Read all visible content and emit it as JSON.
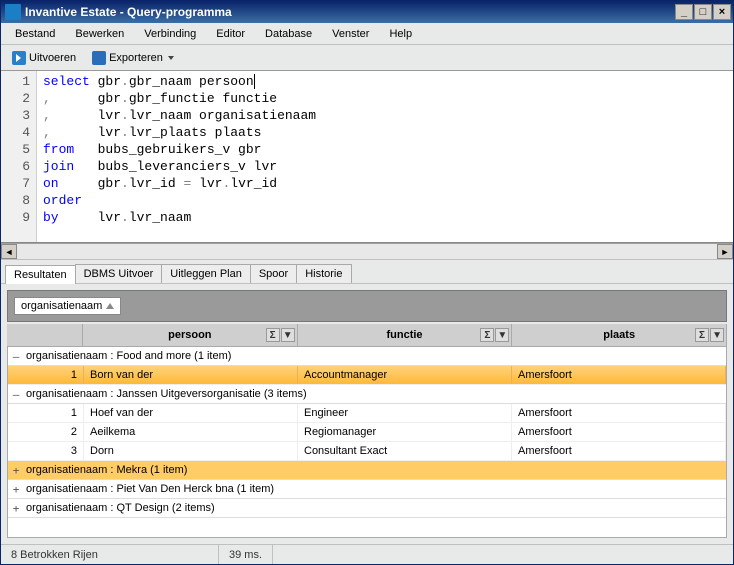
{
  "title": "Invantive Estate - Query-programma",
  "menu": [
    "Bestand",
    "Bewerken",
    "Verbinding",
    "Editor",
    "Database",
    "Venster",
    "Help"
  ],
  "toolbar": {
    "run": "Uitvoeren",
    "export": "Exporteren"
  },
  "code": {
    "lines": [
      "1",
      "2",
      "3",
      "4",
      "5",
      "6",
      "7",
      "8",
      "9"
    ],
    "tokens": [
      [
        {
          "t": "select",
          "c": "kw"
        },
        {
          "t": " gbr"
        },
        {
          "t": ".",
          "c": "pn"
        },
        {
          "t": "gbr_naam persoon"
        }
      ],
      [
        {
          "t": ",",
          "c": "pn"
        },
        {
          "t": "      gbr"
        },
        {
          "t": ".",
          "c": "pn"
        },
        {
          "t": "gbr_functie functie"
        }
      ],
      [
        {
          "t": ",",
          "c": "pn"
        },
        {
          "t": "      lvr"
        },
        {
          "t": ".",
          "c": "pn"
        },
        {
          "t": "lvr_naam organisatienaam"
        }
      ],
      [
        {
          "t": ",",
          "c": "pn"
        },
        {
          "t": "      lvr"
        },
        {
          "t": ".",
          "c": "pn"
        },
        {
          "t": "lvr_plaats plaats"
        }
      ],
      [
        {
          "t": "from",
          "c": "kw"
        },
        {
          "t": "   bubs_gebruikers_v gbr"
        }
      ],
      [
        {
          "t": "join",
          "c": "kw"
        },
        {
          "t": "   bubs_leveranciers_v lvr"
        }
      ],
      [
        {
          "t": "on",
          "c": "kw"
        },
        {
          "t": "     gbr"
        },
        {
          "t": ".",
          "c": "pn"
        },
        {
          "t": "lvr_id "
        },
        {
          "t": "=",
          "c": "pn"
        },
        {
          "t": " lvr"
        },
        {
          "t": ".",
          "c": "pn"
        },
        {
          "t": "lvr_id"
        }
      ],
      [
        {
          "t": "order",
          "c": "kw"
        }
      ],
      [
        {
          "t": "by",
          "c": "kw"
        },
        {
          "t": "     lvr"
        },
        {
          "t": ".",
          "c": "pn"
        },
        {
          "t": "lvr_naam"
        }
      ]
    ]
  },
  "tabs": [
    "Resultaten",
    "DBMS Uitvoer",
    "Uitleggen Plan",
    "Spoor",
    "Historie"
  ],
  "activeTab": 0,
  "grouping": {
    "chip": "organisatienaam"
  },
  "columns": [
    "persoon",
    "functie",
    "plaats"
  ],
  "groups": [
    {
      "expanded": true,
      "hl": false,
      "label": "organisatienaam : Food and more (1 item)",
      "rows": [
        {
          "n": "1",
          "hl": true,
          "cells": [
            "Born van der",
            "Accountmanager",
            "Amersfoort"
          ]
        }
      ]
    },
    {
      "expanded": true,
      "hl": false,
      "label": "organisatienaam : Janssen Uitgeversorganisatie (3 items)",
      "rows": [
        {
          "n": "1",
          "hl": false,
          "cells": [
            "Hoef van der",
            "Engineer",
            "Amersfoort"
          ]
        },
        {
          "n": "2",
          "hl": false,
          "cells": [
            "Aeilkema",
            "Regiomanager",
            "Amersfoort"
          ]
        },
        {
          "n": "3",
          "hl": false,
          "cells": [
            "Dorn",
            "Consultant Exact",
            "Amersfoort"
          ]
        }
      ]
    },
    {
      "expanded": false,
      "hl": true,
      "label": "organisatienaam : Mekra (1 item)",
      "rows": []
    },
    {
      "expanded": false,
      "hl": false,
      "label": "organisatienaam : Piet Van Den Herck bna (1 item)",
      "rows": []
    },
    {
      "expanded": false,
      "hl": false,
      "label": "organisatienaam : QT Design (2 items)",
      "rows": []
    }
  ],
  "status": {
    "rows": "8 Betrokken Rijen",
    "time": "39 ms."
  }
}
